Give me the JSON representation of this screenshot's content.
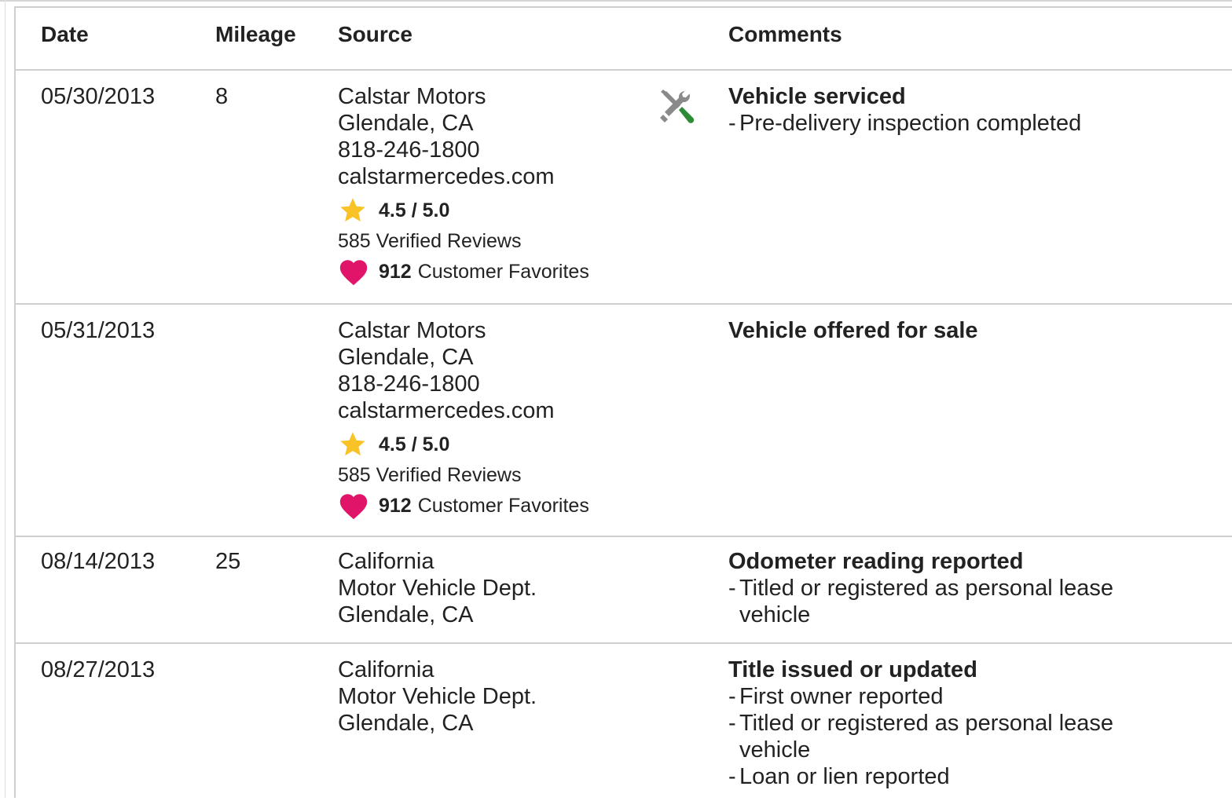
{
  "columns": {
    "date": "Date",
    "mileage": "Mileage",
    "source": "Source",
    "comments": "Comments"
  },
  "colors": {
    "star": "#f9c227",
    "heart": "#e0156a",
    "wrench_gray": "#8a8a8a",
    "wrench_green": "#2e8b35",
    "border": "#cfcfcf"
  },
  "records": [
    {
      "date": "05/30/2013",
      "mileage": "8",
      "source": {
        "name": "Calstar Motors",
        "location": "Glendale, CA",
        "phone": "818-246-1800",
        "website": "calstarmercedes.com",
        "rating": "4.5 / 5.0",
        "reviews": "585 Verified Reviews",
        "favorites_count": "912",
        "favorites_label": "Customer Favorites"
      },
      "icon": "wrench-screwdriver-icon",
      "comment_title": "Vehicle serviced",
      "comment_details": [
        "Pre-delivery inspection completed"
      ]
    },
    {
      "date": "05/31/2013",
      "mileage": "",
      "source": {
        "name": "Calstar Motors",
        "location": "Glendale, CA",
        "phone": "818-246-1800",
        "website": "calstarmercedes.com",
        "rating": "4.5 / 5.0",
        "reviews": "585 Verified Reviews",
        "favorites_count": "912",
        "favorites_label": "Customer Favorites"
      },
      "comment_title": "Vehicle offered for sale",
      "comment_details": []
    },
    {
      "date": "08/14/2013",
      "mileage": "25",
      "source": {
        "name": "California",
        "department": "Motor Vehicle Dept.",
        "location": "Glendale, CA"
      },
      "comment_title": "Odometer reading reported",
      "comment_details": [
        "Titled or registered as personal lease vehicle"
      ]
    },
    {
      "date": "08/27/2013",
      "mileage": "",
      "source": {
        "name": "California",
        "department": "Motor Vehicle Dept.",
        "location": "Glendale, CA"
      },
      "comment_title": "Title issued or updated",
      "comment_details": [
        "First owner reported",
        "Titled or registered as personal lease vehicle",
        "Loan or lien reported"
      ]
    }
  ]
}
